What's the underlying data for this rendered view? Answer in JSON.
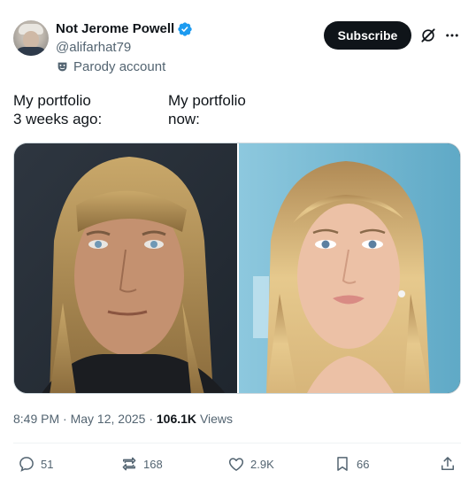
{
  "author": {
    "name": "Not Jerome Powell",
    "handle": "@alifarhat79",
    "label": "Parody account"
  },
  "header": {
    "subscribe_label": "Subscribe"
  },
  "captions": {
    "left_line1": "My portfolio",
    "left_line2": "3 weeks ago:",
    "right_line1": "My portfolio",
    "right_line2": "now:"
  },
  "meta": {
    "time": "8:49 PM",
    "date": "May 12, 2025",
    "views_count": "106.1K",
    "views_label": "Views"
  },
  "actions": {
    "replies": "51",
    "reposts": "168",
    "likes": "2.9K",
    "bookmarks": "66"
  },
  "colors": {
    "text": "#0f1419",
    "secondary": "#536471",
    "verified": "#1d9bf0",
    "button_bg": "#0f1419"
  }
}
